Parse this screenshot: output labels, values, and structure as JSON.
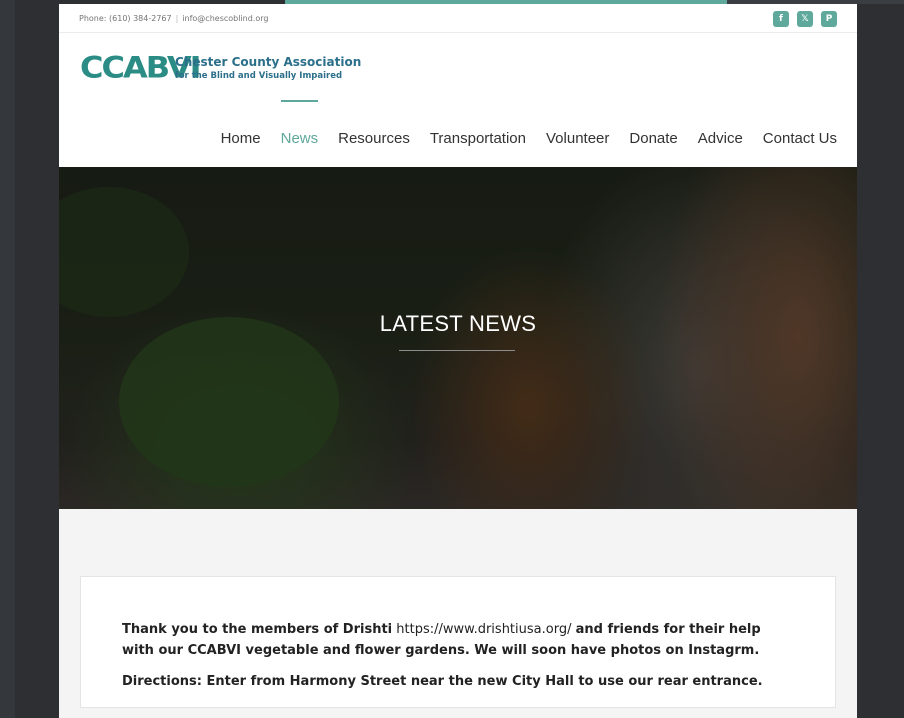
{
  "topbar": {
    "phone": "Phone: (610) 384-2767",
    "separator": "|",
    "email": "info@chescoblind.org",
    "social": [
      {
        "name": "facebook-icon",
        "glyph": "f"
      },
      {
        "name": "x-twitter-icon",
        "glyph": "𝕏"
      },
      {
        "name": "paypal-icon",
        "glyph": "P"
      }
    ]
  },
  "brand": {
    "mark": "CCABVI",
    "line1": "Chester County Association",
    "line2": "for the Blind and Visually Impaired"
  },
  "nav": {
    "items": [
      "Home",
      "News",
      "Resources",
      "Transportation",
      "Volunteer",
      "Donate",
      "Advice",
      "Contact Us"
    ],
    "active": "News"
  },
  "hero": {
    "title": "LATEST NEWS"
  },
  "content": {
    "p1_bold_a": "Thank you to the members of Drishti",
    "p1_link": "https://www.drishtiusa.org/",
    "p1_bold_b": "and friends for their help with our CCABVI vegetable and flower gardens. We will soon have photos on Instagrm.",
    "p2": "Directions: Enter from Harmony Street near the new City Hall to use our rear entrance."
  },
  "colors": {
    "accent": "#5fa89c",
    "brand_blue": "#2b6f8a",
    "background": "#2d2f33"
  }
}
